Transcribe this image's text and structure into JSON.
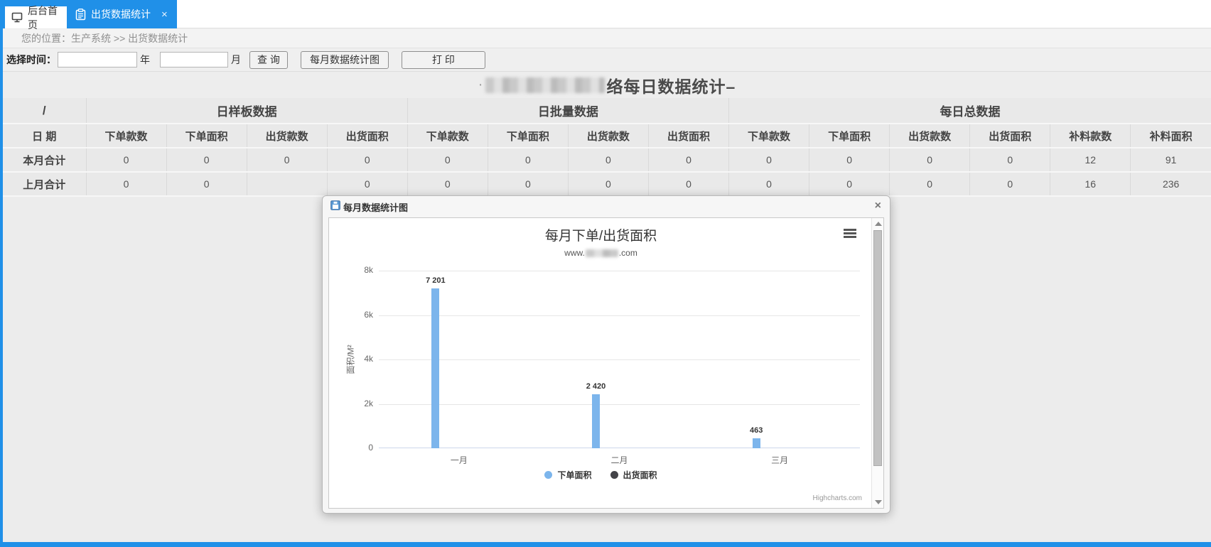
{
  "colors": {
    "accent": "#2090e8",
    "bar_blue": "#7cb5ec",
    "series_dark": "#434348"
  },
  "tabs": {
    "home": {
      "label": "后台首页"
    },
    "active": {
      "label": "出货数据统计",
      "close": "×"
    }
  },
  "breadcrumb": {
    "text": "您的位置：生产系统 >> 出货数据统计"
  },
  "filter": {
    "label": "选择时间：",
    "year_value": "",
    "year_suffix": "年",
    "month_value": "",
    "month_suffix": "月",
    "query_button": "查 询",
    "chart_button": "每月数据统计图",
    "print_button": "打 印"
  },
  "page_title": {
    "leading_char": "·",
    "visible_text": "络每日数据统计–"
  },
  "table": {
    "group_headers": [
      "/",
      "日样板数据",
      "日批量数据",
      "每日总数据"
    ],
    "columns": [
      "日 期",
      "下单款数",
      "下单面积",
      "出货款数",
      "出货面积",
      "下单款数",
      "下单面积",
      "出货款数",
      "出货面积",
      "下单款数",
      "下单面积",
      "出货款数",
      "出货面积",
      "补料款数",
      "补料面积"
    ],
    "rows": [
      {
        "label": "本月合计",
        "values": [
          "0",
          "0",
          "0",
          "0",
          "0",
          "0",
          "0",
          "0",
          "0",
          "0",
          "0",
          "0",
          "12",
          "91"
        ]
      },
      {
        "label": "上月合计",
        "values": [
          "0",
          "0",
          "",
          "0",
          "0",
          "0",
          "0",
          "0",
          "0",
          "0",
          "0",
          "0",
          "16",
          "236"
        ]
      }
    ]
  },
  "dialog": {
    "title": "每月数据统计图",
    "close": "×"
  },
  "chart_data": {
    "type": "bar",
    "title": "每月下单/出货面积",
    "subtitle_prefix": "www.",
    "subtitle_suffix": ".com",
    "categories": [
      "一月",
      "二月",
      "三月"
    ],
    "series": [
      {
        "name": "下单面积",
        "color": "#7cb5ec",
        "values": [
          7201,
          2420,
          463
        ],
        "value_labels": [
          "7 201",
          "2 420",
          "463"
        ]
      },
      {
        "name": "出货面积",
        "color": "#434348",
        "values": [
          0,
          0,
          0
        ],
        "value_labels": []
      }
    ],
    "xlabel": "",
    "ylabel": "面积/M²",
    "yticks": [
      "0",
      "2k",
      "4k",
      "6k",
      "8k"
    ],
    "ylim": [
      0,
      8000
    ],
    "grid": true,
    "legend_position": "bottom",
    "credits": "Highcharts.com"
  }
}
